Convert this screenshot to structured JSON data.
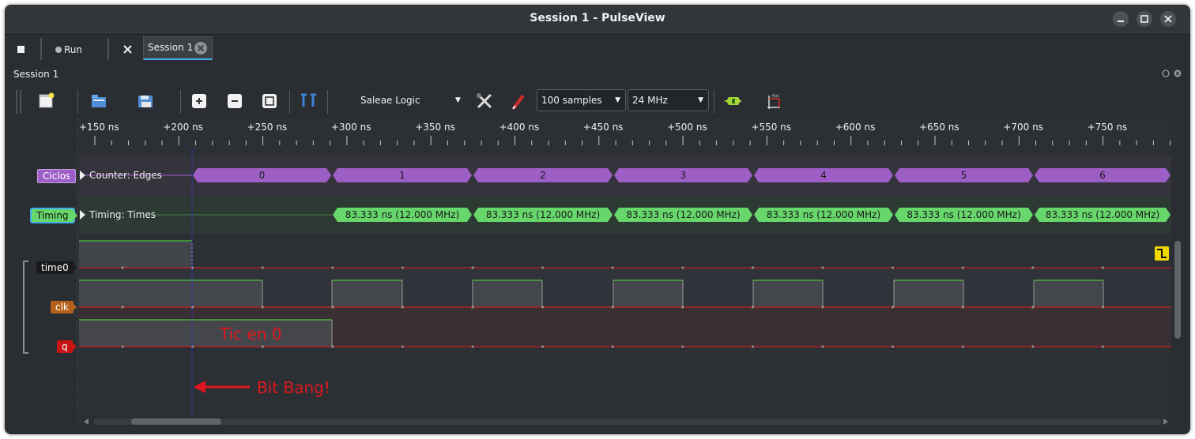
{
  "window": {
    "title": "Session 1 - PulseView",
    "buttons": [
      "minimize",
      "maximize",
      "close"
    ]
  },
  "tabbar": {
    "run_label": "Run",
    "session_tab": "Session 1"
  },
  "panel": {
    "title": "Session 1"
  },
  "toolbar": {
    "device": "Saleae Logic",
    "samples": "100  samples",
    "samplerate": "24 MHz"
  },
  "ruler": {
    "labels": [
      "+150 ns",
      "+200 ns",
      "+250 ns",
      "+300 ns",
      "+350 ns",
      "+400 ns",
      "+450 ns",
      "+500 ns",
      "+550 ns",
      "+600 ns",
      "+650 ns",
      "+700 ns",
      "+750 ns"
    ]
  },
  "decoders": [
    {
      "label": "Ciclos",
      "title": "Counter: Edges",
      "color": "#9d5ec6",
      "values": [
        "0",
        "1",
        "2",
        "3",
        "4",
        "5",
        "6"
      ]
    },
    {
      "label": "Timing",
      "title": "Timing: Times",
      "color": "#67d76c",
      "values": [
        "83.333 ns (12.000 MHz)",
        "83.333 ns (12.000 MHz)",
        "83.333 ns (12.000 MHz)",
        "83.333 ns (12.000 MHz)",
        "83.333 ns (12.000 MHz)",
        "83.333 ns (12.000 MHz)",
        "83.333 ns (12.000 MHz)"
      ]
    }
  ],
  "channels": [
    {
      "label": "time0",
      "color": "#1a1a1a"
    },
    {
      "label": "clk",
      "color": "#b5611a"
    },
    {
      "label": "q",
      "color": "#c81414"
    }
  ],
  "annotations": {
    "tic": "Tic en 0",
    "bitbang": "Bit Bang!"
  },
  "colors": {
    "accent": "#3daee9",
    "trace_low": "#c81d1d",
    "trace_high": "#4ec23c",
    "cursor": "#1f2ea8"
  }
}
